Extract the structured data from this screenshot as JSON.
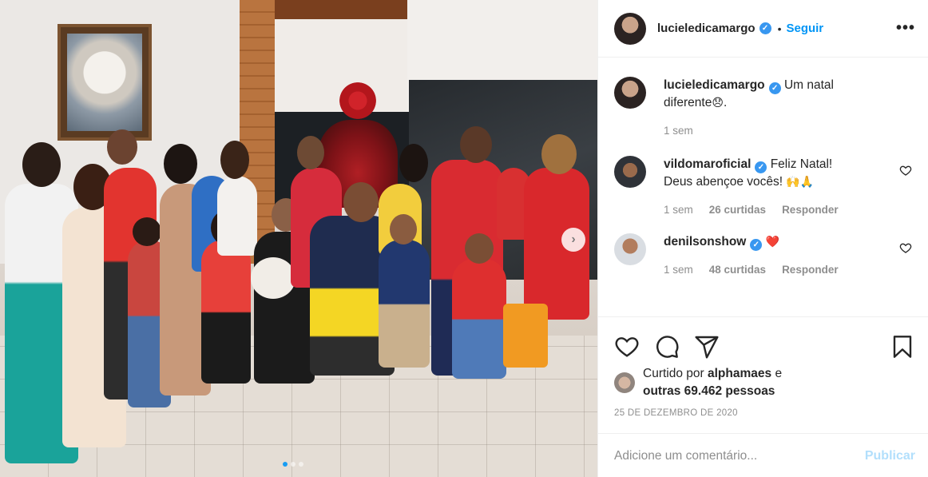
{
  "post": {
    "author": "lucieledicamargo",
    "follow_label": "Seguir",
    "separator": "•",
    "more_label": "•••",
    "caption_text": "Um natal diferente",
    "caption_emoji": "😞",
    "caption_end": ".",
    "caption_time": "1 sem"
  },
  "comments": [
    {
      "username": "vildomaroficial",
      "text": "Feliz Natal! Deus abençoe vocês!",
      "emoji": "🙌🙏",
      "time": "1 sem",
      "likes": "26 curtidas",
      "reply": "Responder"
    },
    {
      "username": "denilsonshow",
      "text": "",
      "emoji": "❤️",
      "time": "1 sem",
      "likes": "48 curtidas",
      "reply": "Responder"
    }
  ],
  "likes": {
    "prefix": "Curtido por",
    "user": "alphamaes",
    "middle": "e",
    "others": "outras 69.462 pessoas"
  },
  "date": "25 DE DEZEMBRO DE 2020",
  "add_comment": {
    "placeholder": "Adicione um comentário...",
    "publish_label": "Publicar"
  },
  "carousel": {
    "slide_count": 3,
    "active_index": 0,
    "next_label": "›"
  },
  "icons": {
    "verified": "verified-badge-icon",
    "like": "heart-icon",
    "comment": "comment-icon",
    "share": "paper-plane-icon",
    "save": "bookmark-icon"
  },
  "colors": {
    "accent": "#0095f6",
    "verified": "#3897f0",
    "publish_disabled": "#b2dffc",
    "muted_text": "#8e8e8e"
  }
}
